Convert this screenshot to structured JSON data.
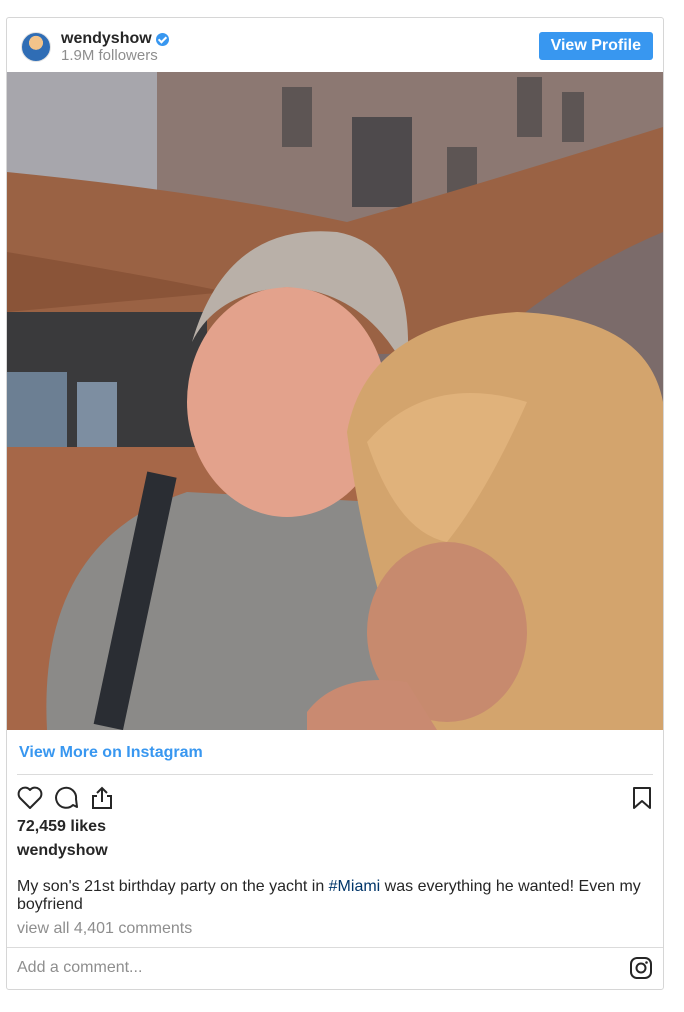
{
  "header": {
    "username": "wendyshow",
    "followers": "1.9M followers",
    "view_profile_label": "View Profile"
  },
  "post": {
    "view_more_label": "View More on Instagram",
    "likes": "72,459 likes",
    "owner": "wendyshow",
    "caption_before": "My son's 21st birthday party on the yacht in ",
    "caption_tag": "#Miami",
    "caption_after": " was everything he wanted! Even my boyfriend",
    "comments_link": "view all 4,401 comments",
    "comment_placeholder": "Add a comment..."
  },
  "icons": {
    "like": "heart-icon",
    "comment": "comment-icon",
    "share": "share-icon",
    "save": "bookmark-icon",
    "instagram": "instagram-icon",
    "verified": "verified-badge-icon"
  },
  "colors": {
    "accent": "#3897f0",
    "hashtag": "#003569",
    "muted": "#8e8e8e"
  }
}
